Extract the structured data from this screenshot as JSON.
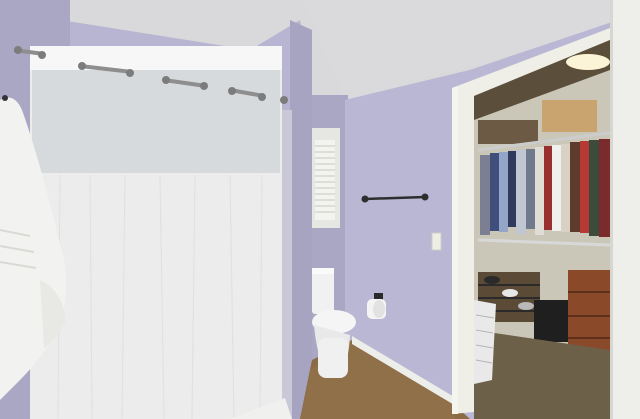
{
  "photo": {
    "scene": "bathroom-with-walk-in-closet",
    "colors": {
      "wall_lavender": "#b7b5d1",
      "wall_shadow": "#a7a5c2",
      "ceiling": "#d9d9db",
      "trim_white": "#efefe8",
      "curtain_white": "#ececec",
      "curtain_mesh": "#d7dadd",
      "floor_tile": "#8a6b44",
      "closet_carpet": "#6d6048",
      "closet_wall": "#cbc7b8",
      "dresser_wood": "#8a4a2a",
      "chrome": "#9a9a9a"
    }
  }
}
